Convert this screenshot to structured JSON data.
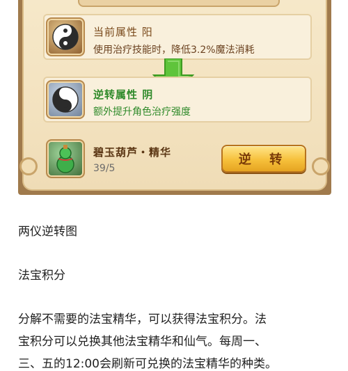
{
  "game_panel": {
    "rows": [
      {
        "title": "当前属性 阳",
        "description": "使用治疗技能时，降低3.2%魔法消耗",
        "icon": "yin-yang-icon"
      },
      {
        "title": "逆转属性 阴",
        "description": "额外提升角色治疗强度",
        "icon": "yin-yang-icon"
      }
    ],
    "item": {
      "name": "碧玉葫芦・精华",
      "count": "39/5",
      "icon": "gourd-icon"
    },
    "reverse_button_label": "逆 转",
    "arrow_icon": "down-arrow-icon",
    "colors": {
      "green_text": "#2f8a2a",
      "button_gold": "#f6c03b",
      "arrow_green": "#5fc43b"
    }
  },
  "article": {
    "caption": "两仪逆转图",
    "heading": "法宝积分",
    "paragraph_lines": [
      "分解不需要的法宝精华，可以获得法宝积分。法",
      "宝积分可以兑换其他法宝精华和仙气。每周一、",
      "三、五的12:00会刷新可兑换的法宝精华的种类。"
    ]
  }
}
